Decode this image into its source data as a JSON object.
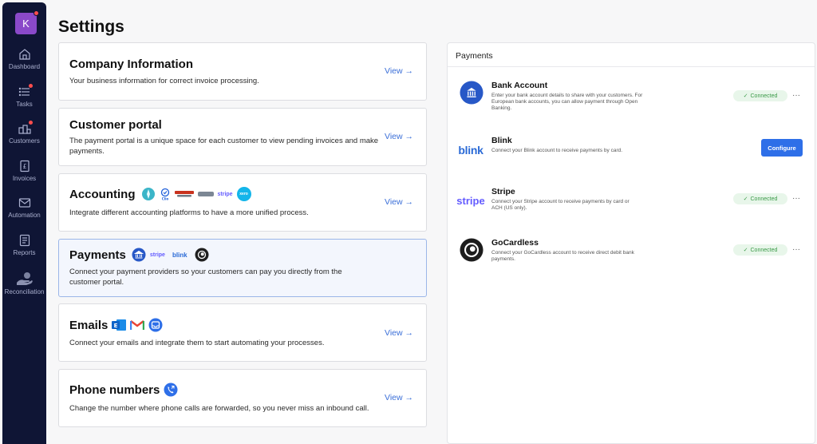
{
  "sidebar": {
    "avatar_letter": "K",
    "items": [
      {
        "label": "Dashboard",
        "icon": "home-icon",
        "dot": false
      },
      {
        "label": "Tasks",
        "icon": "list-icon",
        "dot": true
      },
      {
        "label": "Customers",
        "icon": "customers-icon",
        "dot": true
      },
      {
        "label": "Invoices",
        "icon": "invoice-icon",
        "dot": false
      },
      {
        "label": "Automation",
        "icon": "mail-icon",
        "dot": false
      },
      {
        "label": "Reports",
        "icon": "report-icon",
        "dot": false
      },
      {
        "label": "Reconciliation",
        "icon": "reconciliation-icon",
        "dot": false
      }
    ]
  },
  "page": {
    "title": "Settings"
  },
  "cards": {
    "company": {
      "title": "Company Information",
      "desc": "Your business information for correct invoice processing.",
      "view": "View →"
    },
    "portal": {
      "title": "Customer portal",
      "desc": "The payment portal is a unique space for each customer to view pending invoices and make payments.",
      "view": "View →"
    },
    "accounting": {
      "title": "Accounting",
      "desc": "Integrate different accounting platforms to have a more unified process.",
      "view": "View →",
      "logos": [
        "stripe",
        "xero"
      ]
    },
    "payments": {
      "title": "Payments",
      "desc": "Connect your payment providers so your customers can pay you directly from the customer portal.",
      "logos": [
        "stripe",
        "blink"
      ]
    },
    "emails": {
      "title": "Emails",
      "desc": "Connect your emails and integrate them to start automating your processes.",
      "view": "View →"
    },
    "phone": {
      "title": "Phone numbers",
      "desc": "Change the number where phone calls are forwarded, so you never miss an inbound call.",
      "view": "View →"
    }
  },
  "payments_panel": {
    "title": "Payments",
    "providers": [
      {
        "name": "Bank Account",
        "desc": "Enter your bank account details to share with your customers. For European bank accounts, you can allow payment through Open Banking.",
        "status": "Connected",
        "logo": "bank-icon"
      },
      {
        "name": "Blink",
        "desc": "Connect your Blink account to receive payments by card.",
        "action": "Configure",
        "logo_text": "blink"
      },
      {
        "name": "Stripe",
        "desc": "Connect your Stripe account to receive payments by card or ACH (US only).",
        "status": "Connected",
        "logo_text": "stripe"
      },
      {
        "name": "GoCardless",
        "desc": "Connect your GoCardless account to receive direct debit bank payments.",
        "status": "Connected",
        "logo": "gocardless-icon"
      }
    ],
    "more_label": "···"
  },
  "colors": {
    "sidebar": "#0f1535",
    "accent": "#2e6fe8",
    "link": "#3b6fd8",
    "connected": "#3a9a48",
    "avatar": "#8a49c9"
  }
}
